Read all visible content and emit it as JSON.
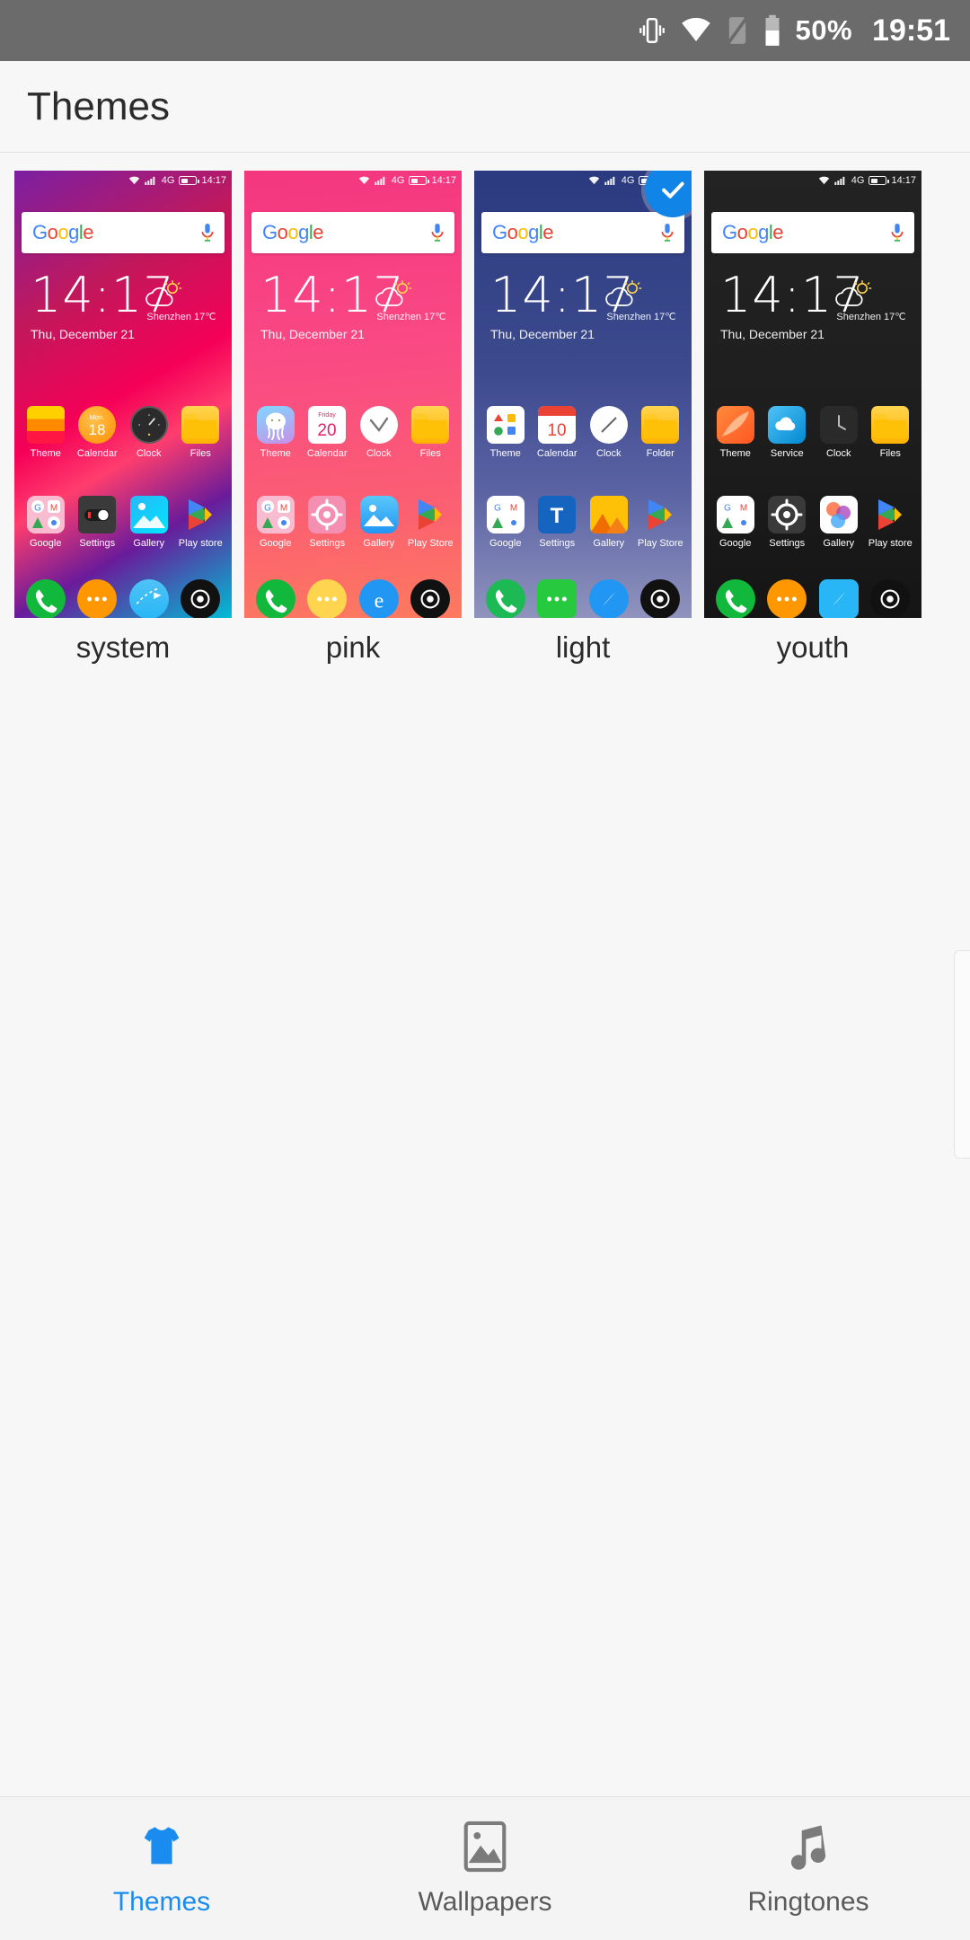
{
  "status_bar": {
    "icons": [
      "vibrate-icon",
      "wifi-icon",
      "sim-off-icon",
      "battery-icon"
    ],
    "battery_percent": "50%",
    "clock": "19:51",
    "background": "#6b6b6b"
  },
  "app_bar": {
    "title": "Themes"
  },
  "accent_color": "#1184e8",
  "preview_common": {
    "mini_status_time": "14:17",
    "mini_status_network": "4G",
    "search_placeholder": "",
    "google_logo": "Google",
    "widget_time": "14:17",
    "widget_date": "Thu,  December 21",
    "weather_city": "Shenzhen 17℃"
  },
  "themes": [
    {
      "name": "system",
      "selected": false,
      "background": "linear-gradient(150deg,#7b1fa2 0%,#c2185b 28%,#f50057 50%,#ff3d6e 62%,#6a1b9a 78%,#00bcd4 100%)",
      "status_tint": "#2a0d3a",
      "row1": [
        {
          "label": "Theme",
          "icon": "theme-stripes-icon"
        },
        {
          "label": "Calendar",
          "icon": "calendar-icon",
          "weekday": "Mon.",
          "day": "18"
        },
        {
          "label": "Clock",
          "icon": "clock-dial-icon"
        },
        {
          "label": "Files",
          "icon": "folder-icon"
        }
      ],
      "row2": [
        {
          "label": "Google",
          "icon": "google-folder-icon"
        },
        {
          "label": "Settings",
          "icon": "settings-toggle-icon"
        },
        {
          "label": "Gallery",
          "icon": "gallery-icon"
        },
        {
          "label": "Play store",
          "icon": "play-store-icon"
        }
      ],
      "dock": [
        {
          "label": "Phone",
          "icon": "phone-icon"
        },
        {
          "label": "Messages",
          "icon": "message-icon"
        },
        {
          "label": "Browser",
          "icon": "browser-globe-icon"
        },
        {
          "label": "Camera",
          "icon": "camera-icon"
        }
      ]
    },
    {
      "name": "pink",
      "selected": false,
      "background": "linear-gradient(175deg,#f4367f 0%,#fa4a84 42%,#fb5f72 75%,#fd7a5e 100%)",
      "status_tint": "#ef3b83",
      "row1": [
        {
          "label": "Theme",
          "icon": "jellyfish-theme-icon"
        },
        {
          "label": "Calendar",
          "icon": "calendar-icon",
          "weekday": "Friday",
          "day": "20"
        },
        {
          "label": "Clock",
          "icon": "clock-dial-icon"
        },
        {
          "label": "Files",
          "icon": "folder-icon"
        }
      ],
      "row2": [
        {
          "label": "Google",
          "icon": "google-folder-icon"
        },
        {
          "label": "Settings",
          "icon": "settings-gear-icon"
        },
        {
          "label": "Gallery",
          "icon": "gallery-icon"
        },
        {
          "label": "Play Store",
          "icon": "play-store-icon"
        }
      ],
      "dock": [
        {
          "label": "Phone",
          "icon": "phone-icon"
        },
        {
          "label": "Messages",
          "icon": "message-icon"
        },
        {
          "label": "Browser",
          "icon": "browser-e-icon"
        },
        {
          "label": "Camera",
          "icon": "camera-icon"
        }
      ]
    },
    {
      "name": "light",
      "selected": true,
      "background": "linear-gradient(180deg,#2b3a7f 0%,#3d4a8e 45%,#5b63a4 72%,#8f93bd 100%)",
      "status_tint": "#2b3a7f",
      "row1": [
        {
          "label": "Theme",
          "icon": "theme-shapes-icon"
        },
        {
          "label": "Calendar",
          "icon": "calendar-icon",
          "weekday": "",
          "day": "10"
        },
        {
          "label": "Clock",
          "icon": "clock-dial-icon"
        },
        {
          "label": "Folder",
          "icon": "folder-icon"
        }
      ],
      "row2": [
        {
          "label": "Google",
          "icon": "google-folder-icon"
        },
        {
          "label": "Settings",
          "icon": "settings-t-icon"
        },
        {
          "label": "Gallery",
          "icon": "gallery-icon"
        },
        {
          "label": "Play Store",
          "icon": "play-store-icon"
        }
      ],
      "dock": [
        {
          "label": "Phone",
          "icon": "phone-icon"
        },
        {
          "label": "Messages",
          "icon": "message-icon"
        },
        {
          "label": "Browser",
          "icon": "browser-compass-icon"
        },
        {
          "label": "Camera",
          "icon": "camera-icon"
        }
      ]
    },
    {
      "name": "youth",
      "selected": false,
      "background": "linear-gradient(180deg,#232323 0%,#1e1e1e 55%,#151515 100%)",
      "status_tint": "#232323",
      "row1": [
        {
          "label": "Theme",
          "icon": "theme-orange-icon"
        },
        {
          "label": "Service",
          "icon": "service-cloud-icon"
        },
        {
          "label": "Clock",
          "icon": "clock-dial-icon"
        },
        {
          "label": "Files",
          "icon": "folder-icon"
        }
      ],
      "row2": [
        {
          "label": "Google",
          "icon": "google-folder-icon"
        },
        {
          "label": "Settings",
          "icon": "settings-gear-icon"
        },
        {
          "label": "Gallery",
          "icon": "gallery-icon"
        },
        {
          "label": "Play store",
          "icon": "play-store-icon"
        }
      ],
      "dock": [
        {
          "label": "Phone",
          "icon": "phone-icon"
        },
        {
          "label": "Messages",
          "icon": "message-icon"
        },
        {
          "label": "Browser",
          "icon": "browser-compass-icon"
        },
        {
          "label": "Camera",
          "icon": "camera-icon"
        }
      ]
    }
  ],
  "bottom_nav": [
    {
      "label": "Themes",
      "icon": "tshirt-icon",
      "active": true
    },
    {
      "label": "Wallpapers",
      "icon": "image-icon",
      "active": false
    },
    {
      "label": "Ringtones",
      "icon": "music-note-icon",
      "active": false
    }
  ]
}
